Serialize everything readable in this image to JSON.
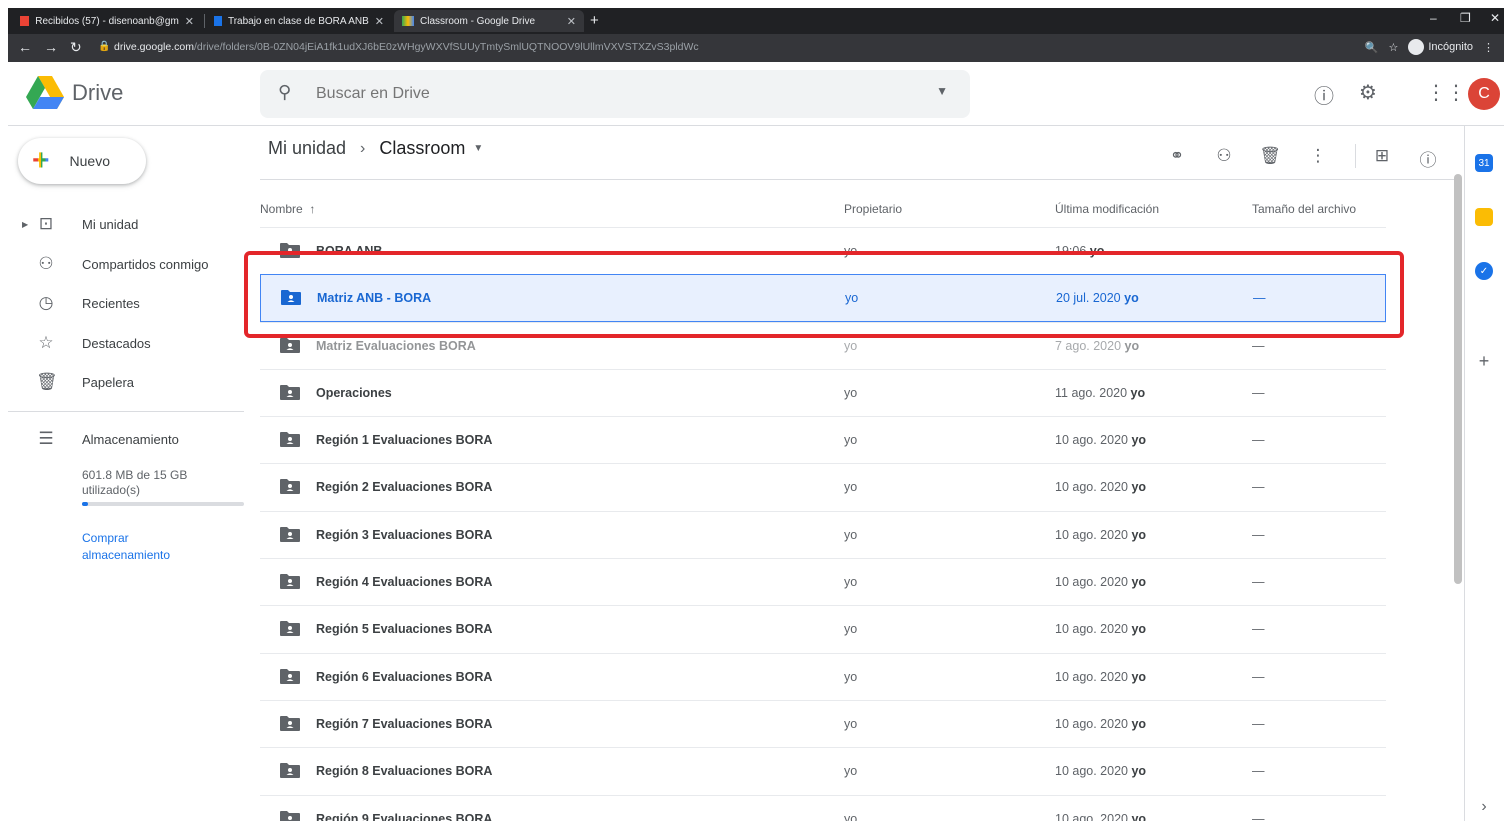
{
  "browser": {
    "tabs": [
      {
        "title": "Recibidos (57) - disenoanb@gm",
        "fav_color": "#ea4335"
      },
      {
        "title": "Trabajo en clase de BORA ANB",
        "fav_color": "#1a73e8"
      },
      {
        "title": "Classroom - Google Drive",
        "fav_color": "#fbbc04"
      }
    ],
    "url_domain": "drive.google.com",
    "url_path": "/drive/folders/0B-0ZN04jEiA1fk1udXJ6bE0zWHgyWXVfSUUyTmtySmlUQTNOOV9lUllmVXVSTXZvS3pldWc",
    "incognito_label": "Incógnito"
  },
  "app": {
    "name": "Drive",
    "search_placeholder": "Buscar en Drive",
    "avatar_letter": "C"
  },
  "sidebar": {
    "new_label": "Nuevo",
    "items": [
      {
        "label": "Mi unidad",
        "icon": "my-drive-icon",
        "glyph": "▣"
      },
      {
        "label": "Compartidos conmigo",
        "icon": "shared-icon",
        "glyph": "👥"
      },
      {
        "label": "Recientes",
        "icon": "recent-icon",
        "glyph": "🕓"
      },
      {
        "label": "Destacados",
        "icon": "star-icon",
        "glyph": "☆"
      },
      {
        "label": "Papelera",
        "icon": "trash-icon",
        "glyph": "🗑"
      }
    ],
    "storage_label": "Almacenamiento",
    "storage_used": "601.8 MB de 15 GB utilizado(s)",
    "storage_fraction": 0.04,
    "buy_storage": "Comprar almacenamiento"
  },
  "breadcrumb": {
    "root": "Mi unidad",
    "current": "Classroom"
  },
  "columns": {
    "name": "Nombre",
    "owner": "Propietario",
    "modified": "Última modificación",
    "size": "Tamaño del archivo"
  },
  "files": [
    {
      "name": "BORA ANB",
      "owner": "yo",
      "date": "19:06",
      "by": "yo",
      "size": "—"
    },
    {
      "name": "Matriz ANB - BORA",
      "owner": "yo",
      "date": "20 jul. 2020",
      "by": "yo",
      "size": "—"
    },
    {
      "name": "Matriz Evaluaciones BORA",
      "owner": "yo",
      "date": "7 ago. 2020",
      "by": "yo",
      "size": "—"
    },
    {
      "name": "Operaciones",
      "owner": "yo",
      "date": "11 ago. 2020",
      "by": "yo",
      "size": "—"
    },
    {
      "name": "Región 1 Evaluaciones BORA",
      "owner": "yo",
      "date": "10 ago. 2020",
      "by": "yo",
      "size": "—"
    },
    {
      "name": "Región 2 Evaluaciones BORA",
      "owner": "yo",
      "date": "10 ago. 2020",
      "by": "yo",
      "size": "—"
    },
    {
      "name": "Región 3 Evaluaciones BORA",
      "owner": "yo",
      "date": "10 ago. 2020",
      "by": "yo",
      "size": "—"
    },
    {
      "name": "Región 4 Evaluaciones BORA",
      "owner": "yo",
      "date": "10 ago. 2020",
      "by": "yo",
      "size": "—"
    },
    {
      "name": "Región 5 Evaluaciones BORA",
      "owner": "yo",
      "date": "10 ago. 2020",
      "by": "yo",
      "size": "—"
    },
    {
      "name": "Región 6 Evaluaciones BORA",
      "owner": "yo",
      "date": "10 ago. 2020",
      "by": "yo",
      "size": "—"
    },
    {
      "name": "Región 7 Evaluaciones BORA",
      "owner": "yo",
      "date": "10 ago. 2020",
      "by": "yo",
      "size": "—"
    },
    {
      "name": "Región 8 Evaluaciones BORA",
      "owner": "yo",
      "date": "10 ago. 2020",
      "by": "yo",
      "size": "—"
    },
    {
      "name": "Región 9 Evaluaciones BORA",
      "owner": "yo",
      "date": "10 ago. 2020",
      "by": "yo",
      "size": "—"
    }
  ],
  "selected_index": 1,
  "colors": {
    "accent": "#1a73e8",
    "highlight_box": "#e3262a",
    "selected_row_bg": "#e8f0fe"
  }
}
